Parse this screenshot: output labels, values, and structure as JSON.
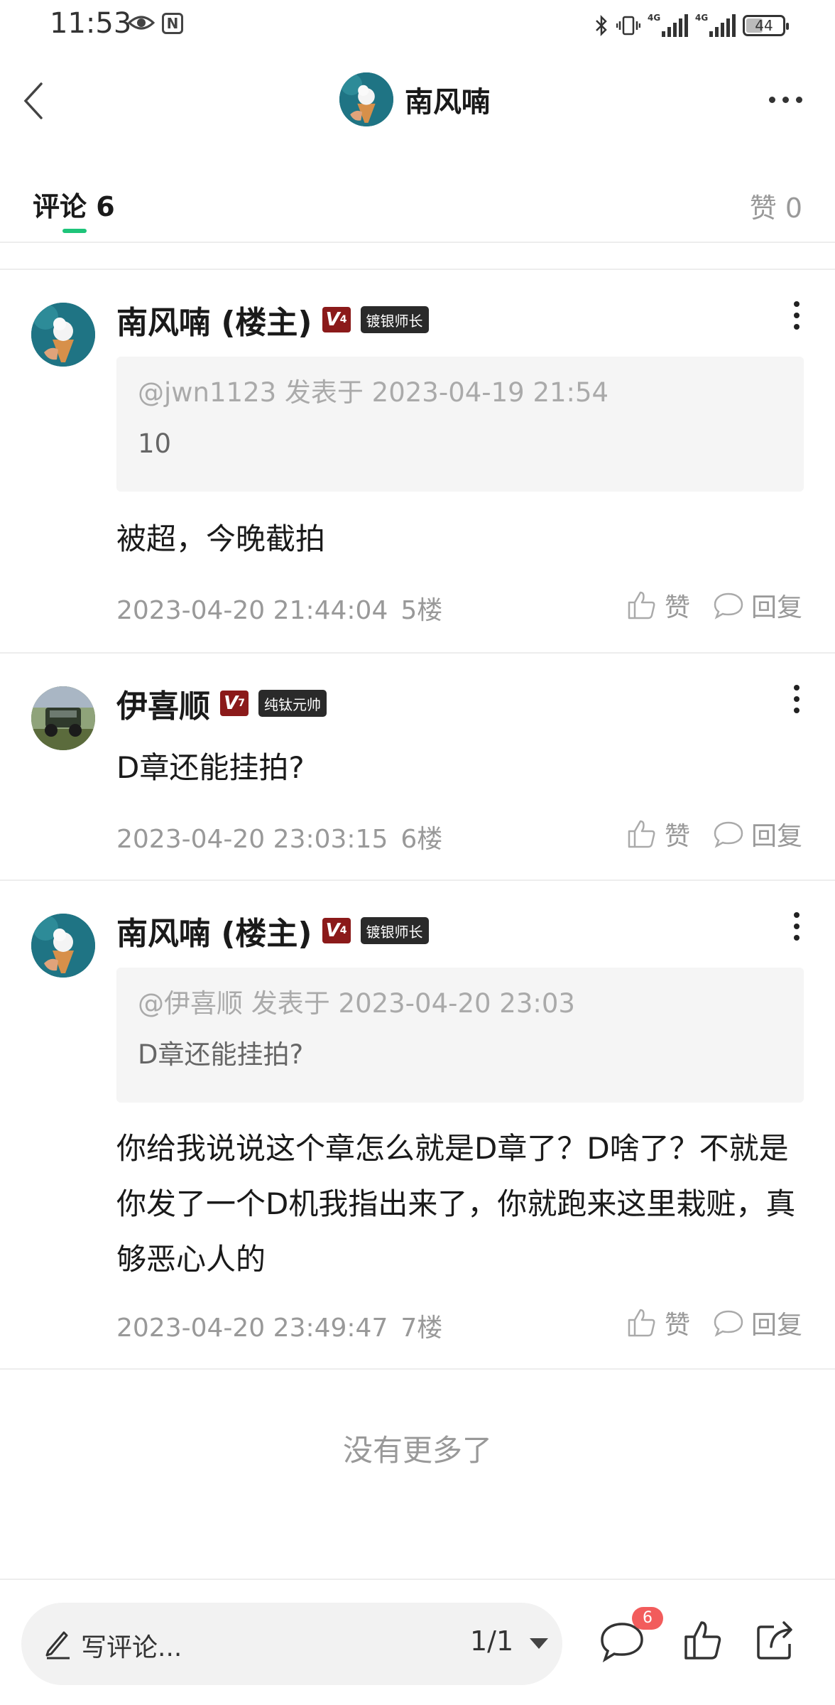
{
  "status_bar": {
    "time": "11:53",
    "n_icon": "N",
    "network_1": "4G",
    "network_2": "4G",
    "battery": "44"
  },
  "nav": {
    "title": "南风喃"
  },
  "tabs": {
    "comment_label": "评论",
    "comment_count": "6",
    "like_label": "赞",
    "like_count": "0",
    "accent_color": "#1ec47a"
  },
  "comments": [
    {
      "name": "南风喃 (楼主)",
      "level": "V",
      "level_num": "4",
      "rank": "镀银师长",
      "quote_head": "@jwn1123 发表于 2023-04-19 21:54",
      "quote_body": "10",
      "text": "被超，今晚截拍",
      "time": "2023-04-20 21:44:04",
      "floor": "5楼",
      "like_label": "赞",
      "reply_label": "回复"
    },
    {
      "name": "伊喜顺",
      "level": "V",
      "level_num": "7",
      "rank": "纯钛元帅",
      "text": "D章还能挂拍?",
      "time": "2023-04-20 23:03:15",
      "floor": "6楼",
      "like_label": "赞",
      "reply_label": "回复"
    },
    {
      "name": "南风喃 (楼主)",
      "level": "V",
      "level_num": "4",
      "rank": "镀银师长",
      "quote_head": "@伊喜顺 发表于 2023-04-20 23:03",
      "quote_body": "D章还能挂拍?",
      "text": "你给我说说这个章怎么就是D章了？D啥了？不就是你发了一个D机我指出来了，你就跑来这里栽赃，真够恶心人的",
      "time": "2023-04-20 23:49:47",
      "floor": "7楼",
      "like_label": "赞",
      "reply_label": "回复"
    }
  ],
  "footer": {
    "no_more": "没有更多了"
  },
  "bottom_bar": {
    "write_placeholder": "写评论...",
    "page_indicator": "1/1",
    "comment_badge": "6",
    "badge_color": "#f25c5c"
  },
  "icons": [
    "eye-icon",
    "back-icon",
    "more-horizontal-icon",
    "more-vertical-icon",
    "thumbs-up-icon",
    "comment-bubble-icon",
    "pencil-icon",
    "share-icon"
  ]
}
